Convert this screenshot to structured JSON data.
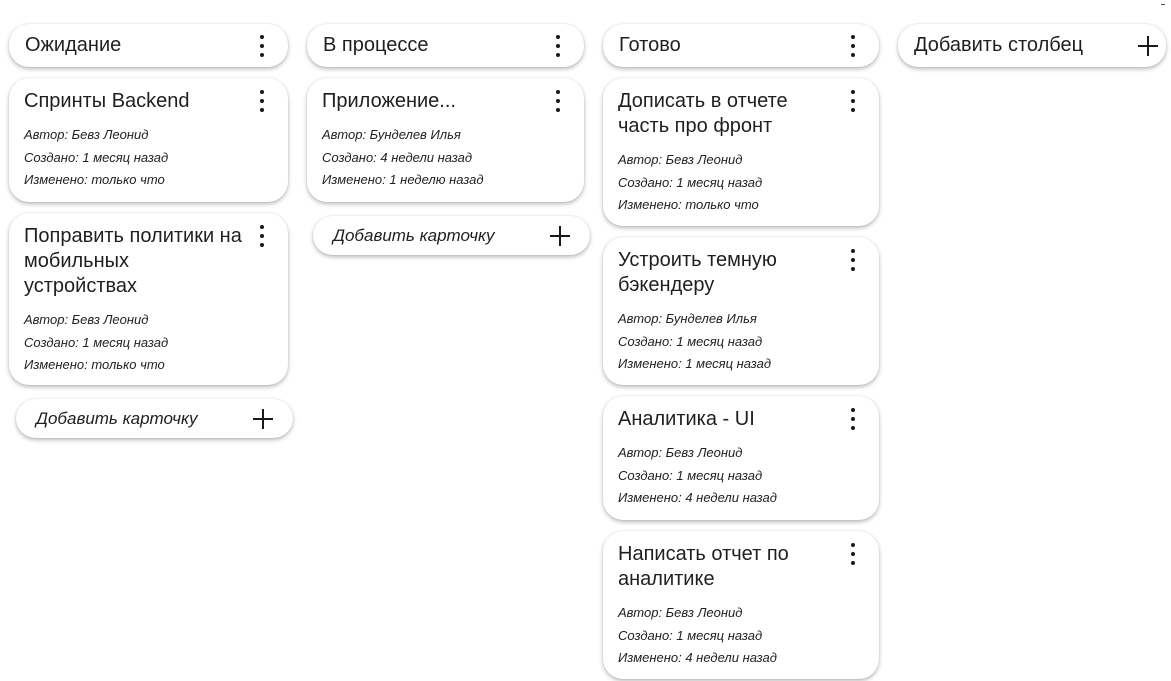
{
  "board": {
    "columns": [
      {
        "title": "Ожидание",
        "cards": [
          {
            "title": "Спринты Backend",
            "author": "Автор: Бевз Леонид",
            "created": "Создано: 1 месяц назад",
            "modified": "Изменено: только что"
          },
          {
            "title": "Поправить политики на мобильных устройствах",
            "author": "Автор: Бевз Леонид",
            "created": "Создано: 1 месяц назад",
            "modified": "Изменено: только что"
          }
        ],
        "add_card_label": "Добавить карточку"
      },
      {
        "title": "В процессе",
        "cards": [
          {
            "title": "Приложение...",
            "author": "Автор: Бунделев Илья",
            "created": "Создано: 4 недели назад",
            "modified": "Изменено: 1 неделю назад"
          }
        ],
        "add_card_label": "Добавить карточку"
      },
      {
        "title": "Готово",
        "cards": [
          {
            "title": "Дописать в отчете часть про фронт",
            "author": "Автор: Бевз Леонид",
            "created": "Создано: 1 месяц назад",
            "modified": "Изменено: только что"
          },
          {
            "title": "Устроить темную бэкендеру",
            "author": "Автор: Бунделев Илья",
            "created": "Создано: 1 месяц назад",
            "modified": "Изменено: 1 месяц назад"
          },
          {
            "title": "Аналитика - UI",
            "author": "Автор: Бевз Леонид",
            "created": "Создано: 1 месяц назад",
            "modified": "Изменено: 4 недели назад"
          },
          {
            "title": "Написать отчет по аналитике",
            "author": "Автор: Бевз Леонид",
            "created": "Создано: 1 месяц назад",
            "modified": "Изменено: 4 недели назад"
          }
        ]
      }
    ],
    "add_column_label": "Добавить столбец"
  },
  "icons": {
    "menu": "kebab-menu-icon",
    "add": "plus-icon"
  }
}
